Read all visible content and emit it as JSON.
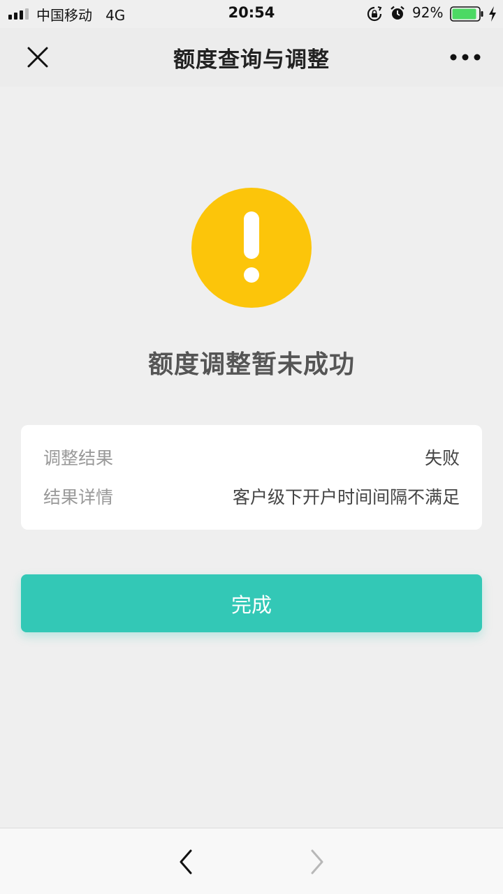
{
  "status_bar": {
    "carrier": "中国移动",
    "network": "4G",
    "time": "20:54",
    "battery_percent": "92%",
    "battery_level": 0.92,
    "battery_color": "#4cd964"
  },
  "nav_bar": {
    "title": "额度查询与调整",
    "close_icon": "close-icon",
    "more_icon": "more-icon"
  },
  "result": {
    "status_icon": "warning-icon",
    "status_color": "#fcc50a",
    "title": "额度调整暂未成功"
  },
  "details": {
    "rows": [
      {
        "label": "调整结果",
        "value": "失败"
      },
      {
        "label": "结果详情",
        "value": "客户级下开户时间间隔不满足"
      }
    ]
  },
  "actions": {
    "done_label": "完成",
    "done_color": "#33c8b6"
  },
  "bottom_bar": {
    "back_icon": "chevron-left-icon",
    "forward_icon": "chevron-right-icon",
    "forward_enabled": false
  }
}
